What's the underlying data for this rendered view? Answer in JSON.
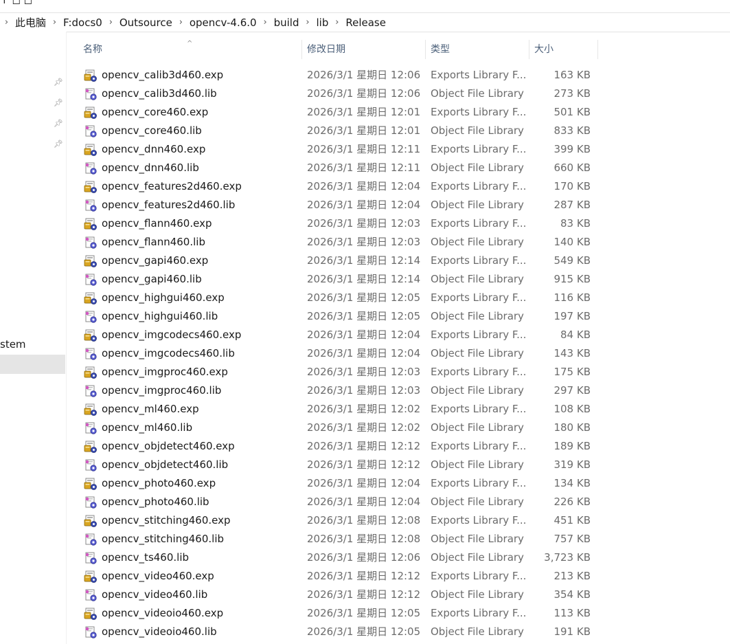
{
  "top_fragment": "↑   ◻ ◻",
  "breadcrumb": [
    "此电脑",
    "F:docs0",
    "Outsource",
    "opencv-4.6.0",
    "build",
    "lib",
    "Release"
  ],
  "nav": {
    "partial_label": "stem",
    "pin_icons": [
      "pin-icon",
      "pin-icon",
      "pin-icon",
      "pin-icon"
    ]
  },
  "columns": {
    "name": "名称",
    "date": "修改日期",
    "type": "类型",
    "size": "大小",
    "sort_indicator": "^"
  },
  "colors": {
    "header_text": "#4c607a",
    "secondary_text": "#6b6b6b",
    "nav_selected": "#e5e5e5"
  },
  "files": [
    {
      "name": "opencv_calib3d460.exp",
      "date": "2026/3/1 星期日 12:06",
      "type": "Exports Library F...",
      "size": "163 KB",
      "icon": "exp-file-icon"
    },
    {
      "name": "opencv_calib3d460.lib",
      "date": "2026/3/1 星期日 12:06",
      "type": "Object File Library",
      "size": "273 KB",
      "icon": "lib-file-icon"
    },
    {
      "name": "opencv_core460.exp",
      "date": "2026/3/1 星期日 12:01",
      "type": "Exports Library F...",
      "size": "501 KB",
      "icon": "exp-file-icon"
    },
    {
      "name": "opencv_core460.lib",
      "date": "2026/3/1 星期日 12:01",
      "type": "Object File Library",
      "size": "833 KB",
      "icon": "lib-file-icon"
    },
    {
      "name": "opencv_dnn460.exp",
      "date": "2026/3/1 星期日 12:11",
      "type": "Exports Library F...",
      "size": "399 KB",
      "icon": "exp-file-icon"
    },
    {
      "name": "opencv_dnn460.lib",
      "date": "2026/3/1 星期日 12:11",
      "type": "Object File Library",
      "size": "660 KB",
      "icon": "lib-file-icon"
    },
    {
      "name": "opencv_features2d460.exp",
      "date": "2026/3/1 星期日 12:04",
      "type": "Exports Library F...",
      "size": "170 KB",
      "icon": "exp-file-icon"
    },
    {
      "name": "opencv_features2d460.lib",
      "date": "2026/3/1 星期日 12:04",
      "type": "Object File Library",
      "size": "287 KB",
      "icon": "lib-file-icon"
    },
    {
      "name": "opencv_flann460.exp",
      "date": "2026/3/1 星期日 12:03",
      "type": "Exports Library F...",
      "size": "83 KB",
      "icon": "exp-file-icon"
    },
    {
      "name": "opencv_flann460.lib",
      "date": "2026/3/1 星期日 12:03",
      "type": "Object File Library",
      "size": "140 KB",
      "icon": "lib-file-icon"
    },
    {
      "name": "opencv_gapi460.exp",
      "date": "2026/3/1 星期日 12:14",
      "type": "Exports Library F...",
      "size": "549 KB",
      "icon": "exp-file-icon"
    },
    {
      "name": "opencv_gapi460.lib",
      "date": "2026/3/1 星期日 12:14",
      "type": "Object File Library",
      "size": "915 KB",
      "icon": "lib-file-icon"
    },
    {
      "name": "opencv_highgui460.exp",
      "date": "2026/3/1 星期日 12:05",
      "type": "Exports Library F...",
      "size": "116 KB",
      "icon": "exp-file-icon"
    },
    {
      "name": "opencv_highgui460.lib",
      "date": "2026/3/1 星期日 12:05",
      "type": "Object File Library",
      "size": "197 KB",
      "icon": "lib-file-icon"
    },
    {
      "name": "opencv_imgcodecs460.exp",
      "date": "2026/3/1 星期日 12:04",
      "type": "Exports Library F...",
      "size": "84 KB",
      "icon": "exp-file-icon"
    },
    {
      "name": "opencv_imgcodecs460.lib",
      "date": "2026/3/1 星期日 12:04",
      "type": "Object File Library",
      "size": "143 KB",
      "icon": "lib-file-icon"
    },
    {
      "name": "opencv_imgproc460.exp",
      "date": "2026/3/1 星期日 12:03",
      "type": "Exports Library F...",
      "size": "175 KB",
      "icon": "exp-file-icon"
    },
    {
      "name": "opencv_imgproc460.lib",
      "date": "2026/3/1 星期日 12:03",
      "type": "Object File Library",
      "size": "297 KB",
      "icon": "lib-file-icon"
    },
    {
      "name": "opencv_ml460.exp",
      "date": "2026/3/1 星期日 12:02",
      "type": "Exports Library F...",
      "size": "108 KB",
      "icon": "exp-file-icon"
    },
    {
      "name": "opencv_ml460.lib",
      "date": "2026/3/1 星期日 12:02",
      "type": "Object File Library",
      "size": "180 KB",
      "icon": "lib-file-icon"
    },
    {
      "name": "opencv_objdetect460.exp",
      "date": "2026/3/1 星期日 12:12",
      "type": "Exports Library F...",
      "size": "189 KB",
      "icon": "exp-file-icon"
    },
    {
      "name": "opencv_objdetect460.lib",
      "date": "2026/3/1 星期日 12:12",
      "type": "Object File Library",
      "size": "319 KB",
      "icon": "lib-file-icon"
    },
    {
      "name": "opencv_photo460.exp",
      "date": "2026/3/1 星期日 12:04",
      "type": "Exports Library F...",
      "size": "134 KB",
      "icon": "exp-file-icon"
    },
    {
      "name": "opencv_photo460.lib",
      "date": "2026/3/1 星期日 12:04",
      "type": "Object File Library",
      "size": "226 KB",
      "icon": "lib-file-icon"
    },
    {
      "name": "opencv_stitching460.exp",
      "date": "2026/3/1 星期日 12:08",
      "type": "Exports Library F...",
      "size": "451 KB",
      "icon": "exp-file-icon"
    },
    {
      "name": "opencv_stitching460.lib",
      "date": "2026/3/1 星期日 12:08",
      "type": "Object File Library",
      "size": "757 KB",
      "icon": "lib-file-icon"
    },
    {
      "name": "opencv_ts460.lib",
      "date": "2026/3/1 星期日 12:06",
      "type": "Object File Library",
      "size": "3,723 KB",
      "icon": "lib-file-icon"
    },
    {
      "name": "opencv_video460.exp",
      "date": "2026/3/1 星期日 12:12",
      "type": "Exports Library F...",
      "size": "213 KB",
      "icon": "exp-file-icon"
    },
    {
      "name": "opencv_video460.lib",
      "date": "2026/3/1 星期日 12:12",
      "type": "Object File Library",
      "size": "354 KB",
      "icon": "lib-file-icon"
    },
    {
      "name": "opencv_videoio460.exp",
      "date": "2026/3/1 星期日 12:05",
      "type": "Exports Library F...",
      "size": "113 KB",
      "icon": "exp-file-icon"
    },
    {
      "name": "opencv_videoio460.lib",
      "date": "2026/3/1 星期日 12:05",
      "type": "Object File Library",
      "size": "191 KB",
      "icon": "lib-file-icon"
    }
  ]
}
